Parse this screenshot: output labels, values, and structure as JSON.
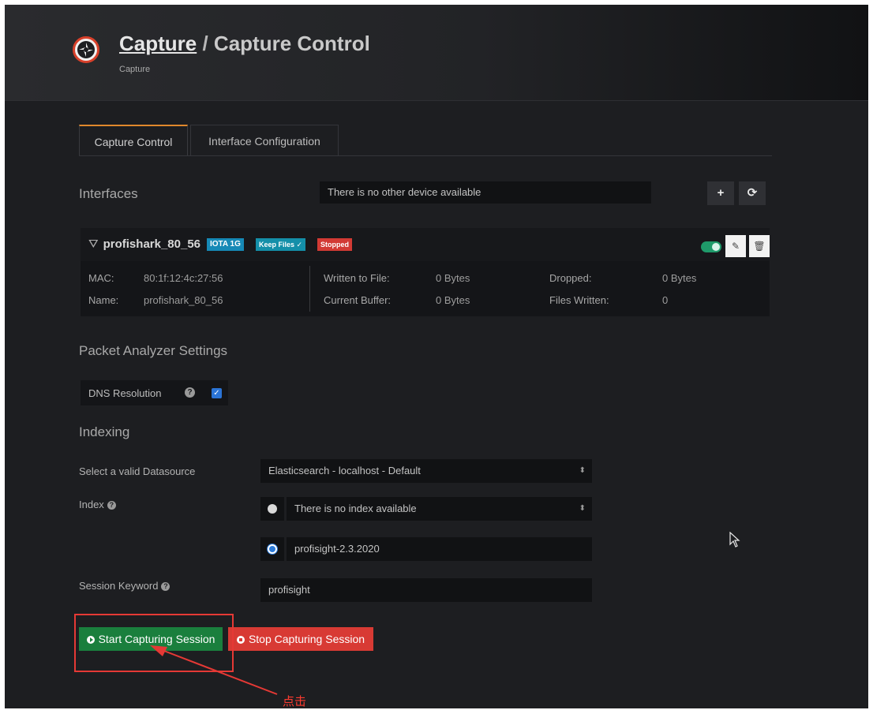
{
  "header": {
    "breadcrumb_link": "Capture",
    "breadcrumb_sep": " / ",
    "breadcrumb_current": "Capture Control",
    "subtitle": "Capture"
  },
  "tabs": [
    {
      "label": "Capture Control",
      "active": true
    },
    {
      "label": "Interface Configuration",
      "active": false
    }
  ],
  "interfaces": {
    "heading": "Interfaces",
    "device_field": "There is no other device available",
    "add_icon": "plus-icon",
    "refresh_icon": "refresh-icon"
  },
  "card": {
    "name": "profishark_80_56",
    "badges": {
      "iota": "IOTA 1G",
      "keep": "Keep Files ✓",
      "stopped": "Stopped"
    },
    "enabled": true,
    "mac_label": "MAC:",
    "mac": "80:1f:12:4c:27:56",
    "name_label": "Name:",
    "name_value": "profishark_80_56",
    "written_label": "Written to File:",
    "written": "0 Bytes",
    "buffer_label": "Current Buffer:",
    "buffer": "0 Bytes",
    "dropped_label": "Dropped:",
    "dropped": "0 Bytes",
    "files_label": "Files Written:",
    "files": "0"
  },
  "packet_analyzer": {
    "heading": "Packet Analyzer Settings",
    "dns_label": "DNS Resolution",
    "dns_checked": true
  },
  "indexing": {
    "heading": "Indexing",
    "datasource_label": "Select a valid Datasource",
    "datasource_value": "Elasticsearch - localhost - Default",
    "index_label": "Index",
    "index_option_1": "There is no index available",
    "index_option_2": "profisight-2.3.2020",
    "selected_index_option": 2,
    "session_keyword_label": "Session Keyword",
    "session_keyword_value": "profisight"
  },
  "actions": {
    "start": "Start Capturing Session",
    "stop": "Stop Capturing Session"
  },
  "annotation": {
    "click_label": "点击",
    "color": "#e53935"
  },
  "colors": {
    "accent_tab": "#e0882c",
    "start_green": "#1a7f3d",
    "stop_red": "#d83a34",
    "badge_blue": "#1689b6",
    "toggle_green": "#1f9a6a"
  }
}
